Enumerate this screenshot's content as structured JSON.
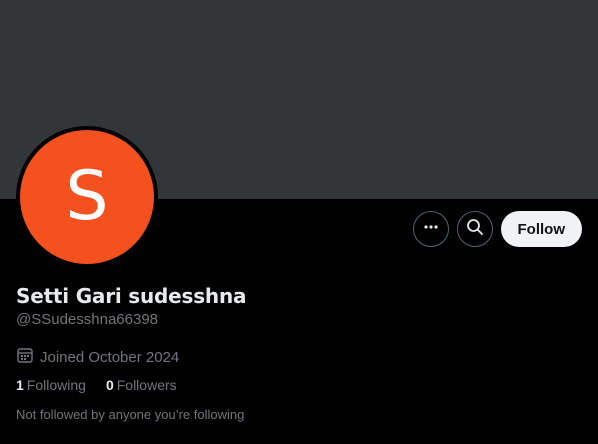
{
  "profile": {
    "avatar_letter": "S",
    "avatar_color": "#f4511e",
    "banner_color": "#333639",
    "display_name": "Setti Gari sudesshna",
    "handle": "@SSudesshna66398",
    "joined": "Joined October 2024",
    "following_count": "1",
    "following_label": "Following",
    "followers_count": "0",
    "followers_label": "Followers",
    "not_followed_text": "Not followed by anyone you’re following"
  },
  "actions": {
    "more_icon": "more-icon",
    "search_icon": "search-icon",
    "follow_label": "Follow"
  }
}
